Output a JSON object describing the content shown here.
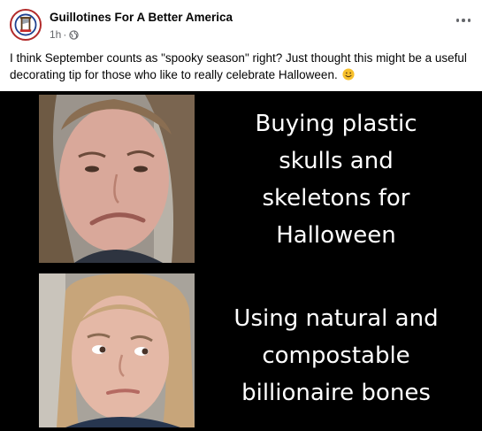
{
  "post": {
    "page_name": "Guillotines For A Better America",
    "time": "1h",
    "separator": "·",
    "text": "I think September counts as \"spooky season\" right? Just thought this might be a useful decorating tip for those who like to really celebrate Halloween.",
    "emoji": "slightly-smiling-face"
  },
  "meme": {
    "top_caption": [
      "Buying plastic",
      "skulls and",
      "skeletons for",
      "Halloween"
    ],
    "bottom_caption": [
      "Using natural and",
      "compostable",
      "billionaire bones"
    ]
  },
  "colors": {
    "meme_background": "#000000",
    "caption_text": "#ffffff",
    "meta_text": "#65676b"
  }
}
